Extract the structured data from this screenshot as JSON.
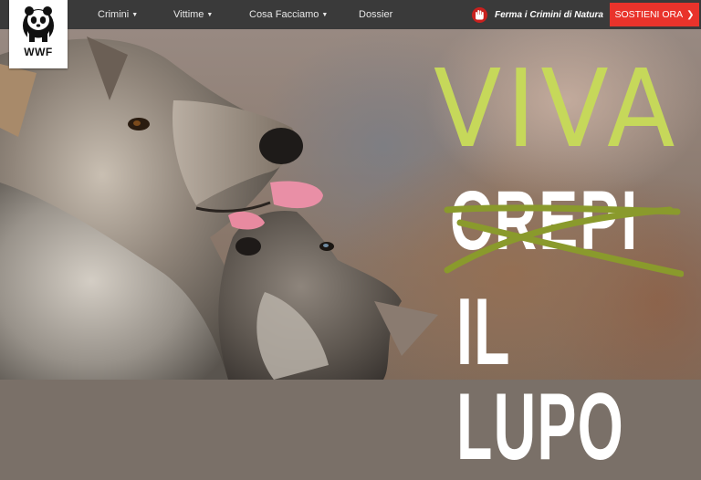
{
  "brand": {
    "logo_text": "WWF"
  },
  "nav": {
    "items": [
      {
        "label": "Crimini",
        "has_dropdown": true
      },
      {
        "label": "Vittime",
        "has_dropdown": true
      },
      {
        "label": "Cosa Facciamo",
        "has_dropdown": true
      },
      {
        "label": "Dossier",
        "has_dropdown": false
      }
    ]
  },
  "campaign": {
    "label": "Ferma i Crimini di Natura",
    "icon": "hand-stop-icon"
  },
  "donate": {
    "label": "SOSTIENI ORA",
    "icon": "chevron-right-icon"
  },
  "hero": {
    "headline_top": "VIVA",
    "headline_struck": "CREPI",
    "headline_bottom": "IL LUPO",
    "image": "wolf-and-cub-photo"
  },
  "colors": {
    "topbar": "#3a3a3a",
    "donate": "#e9332b",
    "viva": "#c6d85a",
    "strike": "#8a9a2c",
    "hand_badge": "#c8201e"
  }
}
